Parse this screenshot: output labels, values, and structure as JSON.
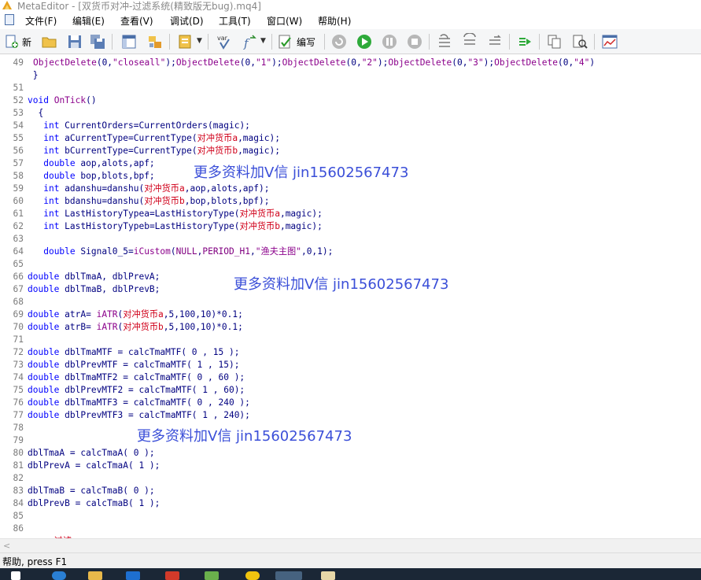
{
  "window": {
    "title": "MetaEditor - [双货币对冲-过滤系统(精致版无bug).mq4]"
  },
  "menu": [
    "文件(F)",
    "编辑(E)",
    "查看(V)",
    "调试(D)",
    "工具(T)",
    "窗口(W)",
    "帮助(H)"
  ],
  "toolbar": {
    "new_label": "新",
    "compile_label": "编写"
  },
  "code_lines": [
    {
      "n": "49",
      "text": "ObjectDelete(0,\"closeall\");ObjectDelete(0,\"1\");ObjectDelete(0,\"2\");ObjectDelete(0,\"3\");ObjectDelete(0,\"4\")"
    },
    {
      "n": "",
      "text": " }"
    },
    {
      "n": "51",
      "text": ""
    },
    {
      "n": "52",
      "text": "void OnTick()"
    },
    {
      "n": "53",
      "text": "  {"
    },
    {
      "n": "54",
      "text": "   int CurrentOrders=CurrentOrders(magic);"
    },
    {
      "n": "55",
      "text": "   int aCurrentType=CurrentType(对冲货币a,magic);"
    },
    {
      "n": "56",
      "text": "   int bCurrentType=CurrentType(对冲货币b,magic);"
    },
    {
      "n": "57",
      "text": "   double aop,alots,apf;"
    },
    {
      "n": "58",
      "text": "   double bop,blots,bpf;"
    },
    {
      "n": "59",
      "text": "   int adanshu=danshu(对冲货币a,aop,alots,apf);"
    },
    {
      "n": "60",
      "text": "   int bdanshu=danshu(对冲货币b,bop,blots,bpf);"
    },
    {
      "n": "61",
      "text": "   int LastHistoryTypea=LastHistoryType(对冲货币a,magic);"
    },
    {
      "n": "62",
      "text": "   int LastHistoryTypeb=LastHistoryType(对冲货币b,magic);"
    },
    {
      "n": "63",
      "text": ""
    },
    {
      "n": "64",
      "text": "   double Signal0_5=iCustom(NULL,PERIOD_H1,\"渔夫主图\",0,1);"
    },
    {
      "n": "65",
      "text": ""
    },
    {
      "n": "66",
      "text": "double dblTmaA, dblPrevA;"
    },
    {
      "n": "67",
      "text": "double dblTmaB, dblPrevB;"
    },
    {
      "n": "68",
      "text": ""
    },
    {
      "n": "69",
      "text": "double atrA= iATR(对冲货币a,5,100,10)*0.1;"
    },
    {
      "n": "70",
      "text": "double atrB= iATR(对冲货币b,5,100,10)*0.1;"
    },
    {
      "n": "71",
      "text": ""
    },
    {
      "n": "72",
      "text": "double dblTmaMTF = calcTmaMTF( 0 , 15 );"
    },
    {
      "n": "73",
      "text": "double dblPrevMTF = calcTmaMTF( 1 , 15);"
    },
    {
      "n": "74",
      "text": "double dblTmaMTF2 = calcTmaMTF( 0 , 60 );"
    },
    {
      "n": "75",
      "text": "double dblPrevMTF2 = calcTmaMTF( 1 , 60);"
    },
    {
      "n": "76",
      "text": "double dblTmaMTF3 = calcTmaMTF( 0 , 240 );"
    },
    {
      "n": "77",
      "text": "double dblPrevMTF3 = calcTmaMTF( 1 , 240);"
    },
    {
      "n": "78",
      "text": ""
    },
    {
      "n": "79",
      "text": ""
    },
    {
      "n": "80",
      "text": "dblTmaA = calcTmaA( 0 );"
    },
    {
      "n": "81",
      "text": "dblPrevA = calcTmaA( 1 );"
    },
    {
      "n": "82",
      "text": ""
    },
    {
      "n": "83",
      "text": "dblTmaB = calcTmaB( 0 );"
    },
    {
      "n": "84",
      "text": "dblPrevB = calcTmaB( 1 );"
    },
    {
      "n": "85",
      "text": ""
    },
    {
      "n": "86",
      "text": ""
    },
    {
      "n": "",
      "text": "     过滤"
    }
  ],
  "watermarks": [
    "更多资料加V信 jin15602567473",
    "更多资料加V信 jin15602567473",
    "更多资料加V信 jin15602567473"
  ],
  "status": {
    "text": "帮助, press F1"
  }
}
